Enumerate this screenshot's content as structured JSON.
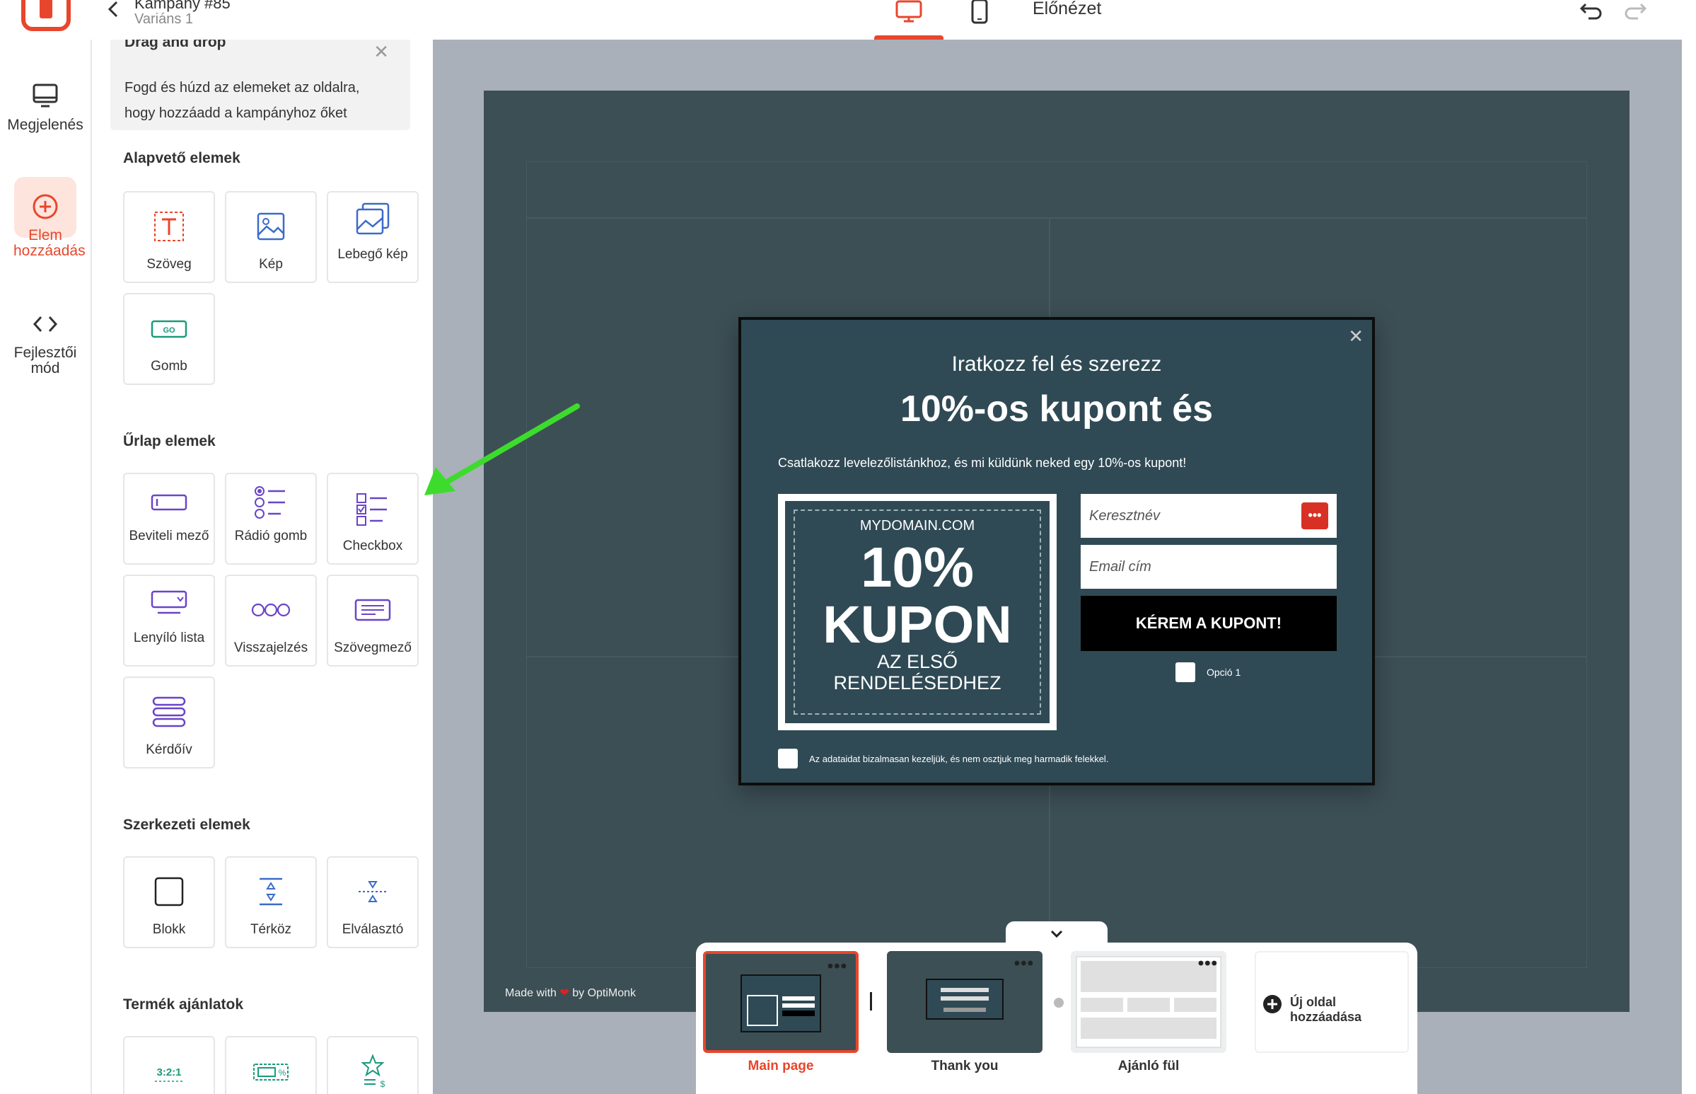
{
  "header": {
    "campaign_title": "Kampány #85",
    "variant": "Variáns 1",
    "preview_label": "Előnézet",
    "active_device": "desktop"
  },
  "rail": {
    "items": [
      {
        "label": "Megjelenés",
        "icon": "monitor-icon"
      },
      {
        "label": "Elem hozzáadás",
        "icon": "plus-circle-icon",
        "active": true
      },
      {
        "label": "Fejlesztői mód",
        "icon": "code-icon"
      }
    ]
  },
  "panel": {
    "dnd_title": "Drag and drop",
    "dnd_text": "Fogd és húzd az elemeket az oldalra, hogy hozzáadd a kampányhoz őket",
    "sections": {
      "basic": {
        "title": "Alapvető elemek",
        "items": [
          "Szöveg",
          "Kép",
          "Lebegő kép",
          "Gomb"
        ]
      },
      "form": {
        "title": "Űrlap elemek",
        "items": [
          "Beviteli mező",
          "Rádió gomb",
          "Checkbox",
          "Lenyíló lista",
          "Visszajelzés",
          "Szövegmező",
          "Kérdőív"
        ]
      },
      "structure": {
        "title": "Szerkezeti elemek",
        "items": [
          "Blokk",
          "Térköz",
          "Elválasztó"
        ]
      },
      "products": {
        "title": "Termék ajánlatok"
      }
    }
  },
  "popup": {
    "subtitle": "Iratkozz fel és szerezz",
    "title": "10%-os kupont és",
    "description": "Csatlakozz levelezőlistánkhoz, és mi küldünk neked egy 10%-os kupont!",
    "coupon": {
      "domain": "MYDOMAIN.COM",
      "percent": "10%",
      "word": "KUPON",
      "line1": "AZ ELSŐ",
      "line2": "RENDELÉSEDHEZ"
    },
    "first_name_placeholder": "Keresztnév",
    "email_placeholder": "Email cím",
    "cta": "KÉREM A KUPONT!",
    "option": "Opció 1",
    "privacy": "Az adataidat bizalmasan kezeljük, és nem osztjuk meg harmadik felekkel."
  },
  "canvas": {
    "made_with": "Made with",
    "by": "by OptiMonk"
  },
  "pages": [
    {
      "label": "Main page",
      "active": true
    },
    {
      "label": "Thank you",
      "active": false
    },
    {
      "label": "Ajánló fül",
      "active": false
    }
  ],
  "add_page_label": "Új oldal hozzáadása",
  "colors": {
    "accent": "#e8462c",
    "stage_bg": "#3c4f55",
    "popup_bg": "#2f4a55",
    "canvas_bg": "#aab0b9",
    "annotation_arrow": "#3ddc2c"
  }
}
